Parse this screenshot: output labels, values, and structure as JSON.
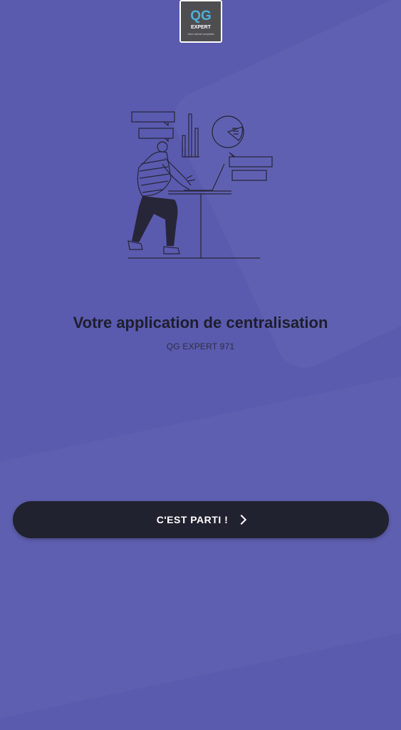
{
  "logo": {
    "letters": "QG",
    "word": "EXPERT",
    "tagline": "Votre cabinet comptable"
  },
  "intro": {
    "headline": "Votre application de centralisation",
    "subtitle": "QG EXPERT 971"
  },
  "start_button": {
    "label": "C'EST PARTI !",
    "icon": "chevron-right-icon"
  },
  "colors": {
    "background": "#5a5aaf",
    "button": "#21222f",
    "headline": "#1e1e2e",
    "logo_accent": "#4fb0d8"
  }
}
